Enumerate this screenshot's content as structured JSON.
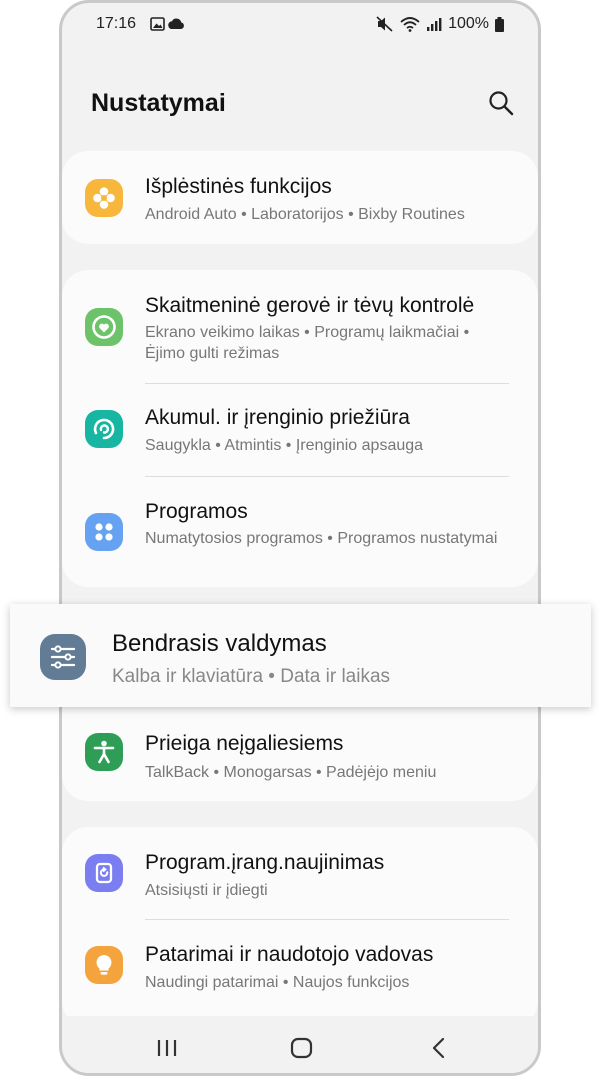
{
  "status_bar": {
    "time": "17:16",
    "battery": "100%"
  },
  "header": {
    "title": "Nustatymai"
  },
  "settings": {
    "advanced": {
      "title": "Išplėstinės funkcijos",
      "subtitle": "Android Auto  •  Laboratorijos  •  Bixby Routines",
      "color": "#f6b73c"
    },
    "wellbeing": {
      "title": "Skaitmeninė gerovė ir tėvų kontrolė",
      "subtitle": "Ekrano veikimo laikas  •  Programų laikmačiai  •  Ėjimo gulti režimas",
      "color": "#6cc36a"
    },
    "care": {
      "title": "Akumul. ir įrenginio priežiūra",
      "subtitle": "Saugykla  •  Atmintis  •  Įrenginio apsauga",
      "color": "#17b6a2"
    },
    "apps": {
      "title": "Programos",
      "subtitle": "Numatytosios programos  •  Programos nustatymai",
      "color": "#66a2f2"
    },
    "general": {
      "title": "Bendrasis valdymas",
      "subtitle": "Kalba ir klaviatūra  •  Data ir laikas",
      "color": "#637c95"
    },
    "accessibility": {
      "title": "Prieiga neįgaliesiems",
      "subtitle": "TalkBack  •  Monogarsas  •  Padėjėjo meniu",
      "color": "#2e9e57"
    },
    "update": {
      "title": "Program.įrang.naujinimas",
      "subtitle": "Atsisiųsti ir įdiegti",
      "color": "#7b7ef0"
    },
    "tips": {
      "title": "Patarimai ir naudotojo vadovas",
      "subtitle": "Naudingi patarimai  •  Naujos funkcijos",
      "color": "#f5a33c"
    }
  }
}
